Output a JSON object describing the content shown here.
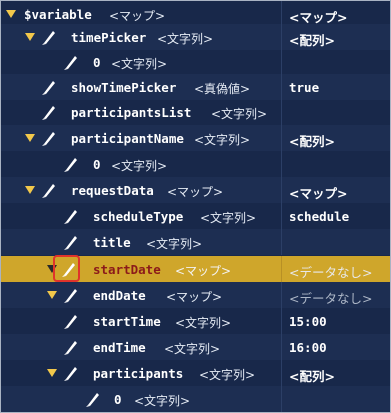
{
  "colors": {
    "background": "#18284a",
    "selected_row": "#cfa62b",
    "twisty": "#f2c84b",
    "highlight_box": "#e0332b"
  },
  "rows": [
    {
      "name": "$variable",
      "type": "<マップ>",
      "value": "<マップ>",
      "expanded": true
    },
    {
      "name": "timePicker",
      "type": "<文字列>",
      "value": "<配列>",
      "expanded": true,
      "icon": "pencil-icon"
    },
    {
      "name": "0",
      "type": "<文字列>",
      "value": "",
      "icon": "pencil-icon"
    },
    {
      "name": "showTimePicker",
      "type": "<真偽値>",
      "value": "true",
      "icon": "pencil-icon"
    },
    {
      "name": "participantsList",
      "type": "<文字列>",
      "value": "",
      "icon": "pencil-icon"
    },
    {
      "name": "participantName",
      "type": "<文字列>",
      "value": "<配列>",
      "expanded": true,
      "icon": "pencil-icon"
    },
    {
      "name": "0",
      "type": "<文字列>",
      "value": "",
      "icon": "pencil-icon"
    },
    {
      "name": "requestData",
      "type": "<マップ>",
      "value": "<マップ>",
      "expanded": true,
      "icon": "pencil-icon"
    },
    {
      "name": "scheduleType",
      "type": "<文字列>",
      "value": "schedule",
      "icon": "pencil-icon"
    },
    {
      "name": "title",
      "type": "<文字列>",
      "value": "",
      "icon": "pencil-icon"
    },
    {
      "name": "startDate",
      "type": "<マップ>",
      "value": "<データなし>",
      "expanded": true,
      "selected": true,
      "icon": "pencil-icon"
    },
    {
      "name": "endDate",
      "type": "<マップ>",
      "value": "<データなし>",
      "expanded": true,
      "icon": "pencil-icon"
    },
    {
      "name": "startTime",
      "type": "<文字列>",
      "value": "15:00",
      "icon": "pencil-icon"
    },
    {
      "name": "endTime",
      "type": "<文字列>",
      "value": "16:00",
      "icon": "pencil-icon"
    },
    {
      "name": "participants",
      "type": "<文字列>",
      "value": "<配列>",
      "expanded": true,
      "icon": "pencil-icon"
    },
    {
      "name": "0",
      "type": "<文字列>",
      "value": "",
      "icon": "pencil-icon"
    }
  ]
}
